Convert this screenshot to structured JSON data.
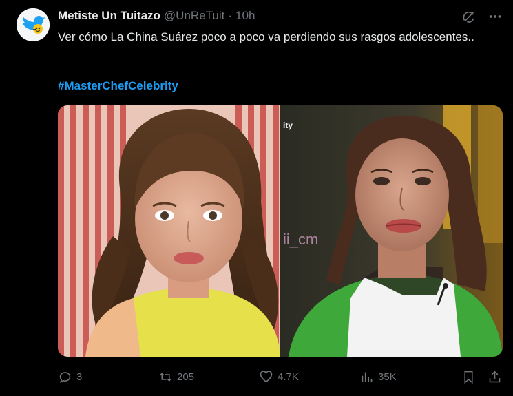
{
  "tweet": {
    "display_name": "Metiste Un Tuitazo",
    "handle": "@UnReTuit",
    "separator": "·",
    "time": "10h",
    "text": "Ver cómo La China Suárez poco a poco va perdiendo sus rasgos adolescentes..",
    "hashtag": "#MasterChefCelebrity",
    "media": {
      "left_watermark": "",
      "right_watermark_top": "ity",
      "right_watermark_mid": "ii_cm"
    }
  },
  "actions": {
    "replies": "3",
    "reposts": "205",
    "likes": "4.7K",
    "views": "35K"
  },
  "icons": {
    "avatar": "bird-logo-icon",
    "grok": "grok-icon",
    "more": "more-dots-icon",
    "reply": "reply-icon",
    "repost": "repost-icon",
    "like": "heart-icon",
    "views": "views-icon",
    "bookmark": "bookmark-icon",
    "share": "share-icon"
  },
  "colors": {
    "background": "#000000",
    "text": "#e7e9ea",
    "muted": "#71767b",
    "accent": "#1d9bf0"
  }
}
